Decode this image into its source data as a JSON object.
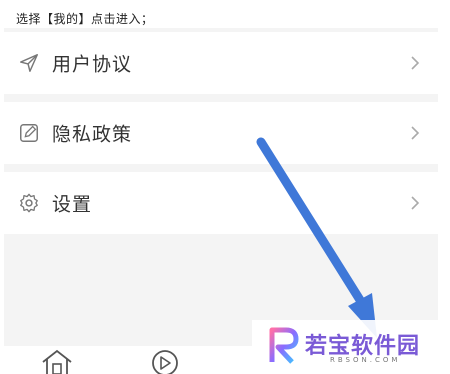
{
  "instruction": "选择【我的】点击进入；",
  "menu": [
    {
      "label": "用户协议",
      "icon": "send-icon"
    },
    {
      "label": "隐私政策",
      "icon": "edit-icon"
    },
    {
      "label": "设置",
      "icon": "gear-icon"
    }
  ],
  "bottom_nav": [
    {
      "icon": "home-icon"
    },
    {
      "icon": "play-icon"
    }
  ],
  "watermark": {
    "text": "若宝软件园",
    "sub": "RBSON.COM"
  },
  "colors": {
    "arrow": "#3f78d8",
    "panel": "#f4f4f4",
    "text": "#333333"
  }
}
